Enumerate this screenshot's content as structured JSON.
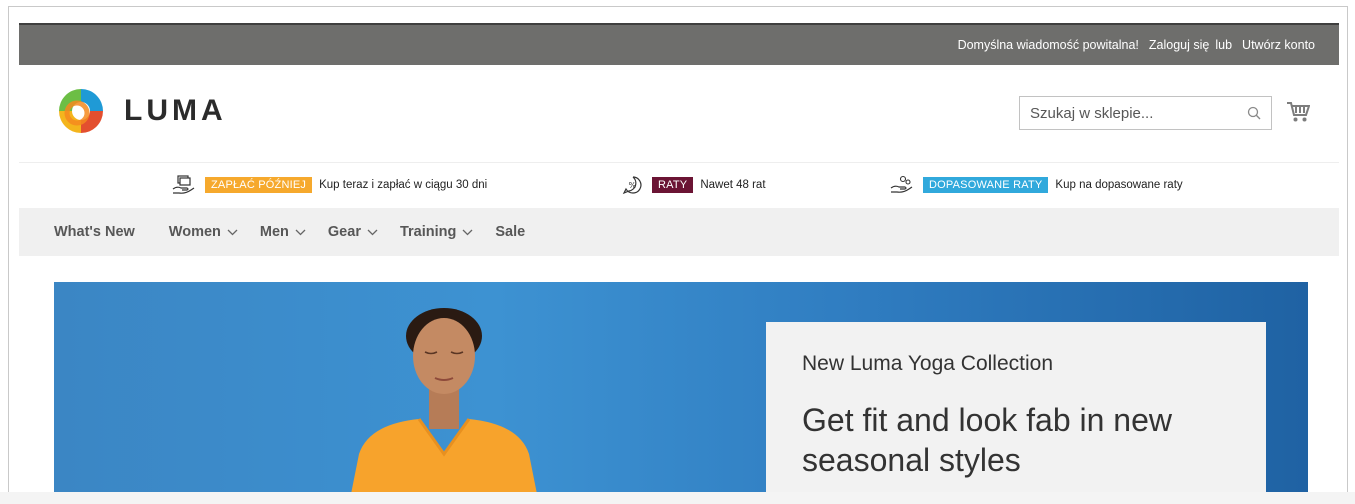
{
  "panel": {
    "welcome": "Domyślna wiadomość powitalna!",
    "sign_in": "Zaloguj się",
    "or": "lub",
    "create_account": "Utwórz konto"
  },
  "header": {
    "logo_text": "LUMA",
    "search_placeholder": "Szukaj w sklepie...",
    "icons": [
      "search-icon",
      "cart-icon"
    ]
  },
  "promos": [
    {
      "icon": "hand-bills-icon",
      "badge": "ZAPŁAĆ PÓŹNIEJ",
      "badge_color": "#f6a92d",
      "text": "Kup teraz i zapłać w ciągu 30 dni"
    },
    {
      "icon": "percent-badge-icon",
      "badge": "RATY",
      "badge_color": "#6b1434",
      "text": "Nawet 48 rat"
    },
    {
      "icon": "hand-coins-icon",
      "badge": "DOPASOWANE RATY",
      "badge_color": "#31a9dc",
      "text": "Kup na dopasowane raty"
    }
  ],
  "nav": {
    "items": [
      {
        "label": "What's New",
        "has_dropdown": false
      },
      {
        "label": "Women",
        "has_dropdown": true
      },
      {
        "label": "Men",
        "has_dropdown": true
      },
      {
        "label": "Gear",
        "has_dropdown": true
      },
      {
        "label": "Training",
        "has_dropdown": true
      },
      {
        "label": "Sale",
        "has_dropdown": false
      }
    ]
  },
  "hero": {
    "eyebrow": "New Luma Yoga Collection",
    "title": "Get fit and look fab in new seasonal styles"
  },
  "colors": {
    "panel_bg": "#6e6e6c",
    "nav_bg": "#f0f0f0",
    "hero_blue": "#3d92d2"
  }
}
